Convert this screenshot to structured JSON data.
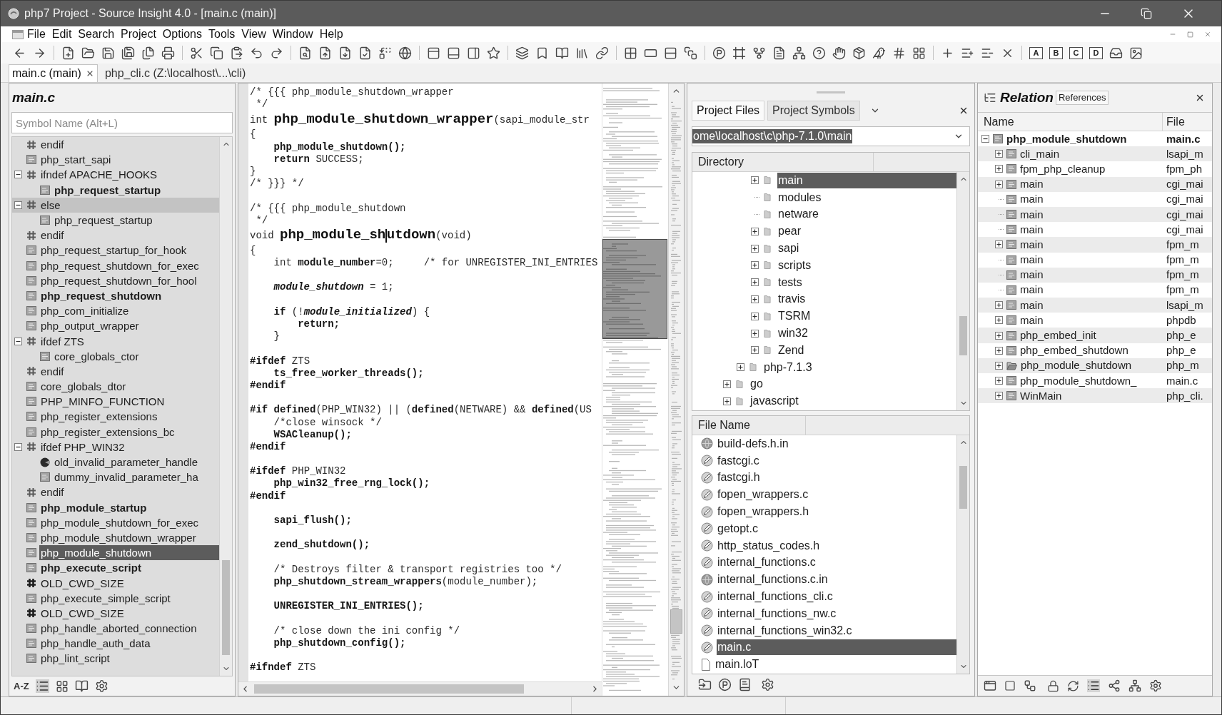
{
  "window": {
    "title": "php7 Project - Source Insight 4.0 - [main.c (main)]"
  },
  "menu_bar": [
    "File",
    "Edit",
    "Search",
    "Project",
    "Options",
    "Tools",
    "View",
    "Window",
    "Help"
  ],
  "toolbar": {
    "bookmark_buttons": [
      "A",
      "B",
      "C",
      "D"
    ]
  },
  "editor_tabs": [
    {
      "label": "main.c (main)",
      "selected": true
    },
    {
      "label": "php_cli.c (Z:\\localhost\\...\\cli)",
      "selected": false
    }
  ],
  "symbol_panel": {
    "title": "main.c",
    "search": {
      "placeholder": "Symbol Name (Alt+L)"
    },
    "sort_button": "A-Z",
    "items": [
      {
        "label": "endif",
        "kind": "directive",
        "bold": false,
        "selected": false,
        "highlighted": false
      },
      {
        "label": "php_start_sapi",
        "kind": "function",
        "bold": false,
        "selected": false,
        "highlighted": false
      },
      {
        "label": "ifndef APACHE_HOOKS",
        "kind": "directive",
        "bold": false,
        "selected": false,
        "highlighted": false,
        "children": [
          {
            "label": "php_request_startup",
            "kind": "function",
            "bold": true,
            "selected": false,
            "highlighted": false
          }
        ]
      },
      {
        "label": "else",
        "kind": "directive",
        "bold": false,
        "selected": false,
        "highlighted": true,
        "children": [
          {
            "label": "php_request_startup",
            "kind": "function",
            "bold": false,
            "selected": false,
            "highlighted": false
          }
        ]
      },
      {
        "label": "endif",
        "kind": "directive",
        "bold": false,
        "selected": false,
        "highlighted": false
      },
      {
        "label": "php_request_startup_for_hook",
        "kind": "function",
        "bold": false,
        "selected": false,
        "highlighted": false
      },
      {
        "label": "php_request_shutdown_for_exec",
        "kind": "function",
        "bold": false,
        "selected": false,
        "highlighted": false
      },
      {
        "label": "php_request_shutdown_for_hool",
        "kind": "function",
        "bold": false,
        "selected": false,
        "highlighted": false
      },
      {
        "label": "php_request_shutdown",
        "kind": "function",
        "bold": true,
        "selected": false,
        "highlighted": false
      },
      {
        "label": "php_com_initialize",
        "kind": "function",
        "bold": false,
        "selected": false,
        "highlighted": false
      },
      {
        "label": "php_output_wrapper",
        "kind": "function",
        "bold": false,
        "selected": false,
        "highlighted": false
      },
      {
        "label": "ifdef ZTS",
        "kind": "directive",
        "bold": false,
        "selected": false,
        "highlighted": false,
        "children": [
          {
            "label": "core_globals_ctor",
            "kind": "function",
            "bold": false,
            "selected": false,
            "highlighted": false
          }
        ]
      },
      {
        "label": "endif",
        "kind": "directive",
        "bold": false,
        "selected": false,
        "highlighted": false
      },
      {
        "label": "core_globals_dtor",
        "kind": "function",
        "bold": false,
        "selected": false,
        "highlighted": false
      },
      {
        "label": "PHP_MINFO_FUNCTION",
        "kind": "function",
        "bold": false,
        "selected": false,
        "highlighted": false
      },
      {
        "label": "php_register_extensions",
        "kind": "function",
        "bold": false,
        "selected": false,
        "highlighted": false
      },
      {
        "label": "php_register_extensions_bc",
        "kind": "function",
        "bold": false,
        "selected": false,
        "highlighted": false
      },
      {
        "label": "ifdef PHP_WIN32",
        "kind": "directive",
        "bold": false,
        "selected": false,
        "highlighted": false,
        "children": [
          {
            "label": "old_invalid_parameter_handle",
            "kind": "variable",
            "bold": false,
            "selected": false,
            "highlighted": false
          },
          {
            "label": "dummy_invalid_parameter_ha",
            "kind": "function",
            "bold": false,
            "selected": false,
            "highlighted": false
          }
        ]
      },
      {
        "label": "endif",
        "kind": "directive",
        "bold": false,
        "selected": false,
        "highlighted": false
      },
      {
        "label": "php_module_startup",
        "kind": "function",
        "bold": true,
        "selected": false,
        "highlighted": false
      },
      {
        "label": "php_module_shutdown_for_exec",
        "kind": "function",
        "bold": false,
        "selected": false,
        "highlighted": false
      },
      {
        "label": "php_module_shutdown_wrapper",
        "kind": "function",
        "bold": false,
        "selected": false,
        "highlighted": false
      },
      {
        "label": "php_module_shutdown",
        "kind": "function",
        "bold": false,
        "selected": true,
        "highlighted": false
      },
      {
        "label": "php_execute_script",
        "kind": "function",
        "bold": true,
        "selected": false,
        "highlighted": false
      },
      {
        "label": "OLD_CWD_SIZE",
        "kind": "macro",
        "bold": false,
        "selected": false,
        "highlighted": false
      },
      {
        "label": "php_execute_simple_script",
        "kind": "function",
        "bold": false,
        "selected": false,
        "highlighted": false
      },
      {
        "label": "OLD_CWD_SIZE",
        "kind": "macro",
        "bold": false,
        "selected": false,
        "highlighted": false
      },
      {
        "label": "php_handle_aborted_connection",
        "kind": "function",
        "bold": false,
        "selected": false,
        "highlighted": false
      },
      {
        "label": "php_handle_auth_data",
        "kind": "function",
        "bold": false,
        "selected": false,
        "highlighted": false
      },
      {
        "label": "php_lint_script",
        "kind": "function",
        "bold": false,
        "selected": false,
        "highlighted": false
      }
    ]
  },
  "editor": {
    "lines": [
      {
        "kind": "text",
        "segments": [
          {
            "kind": "plain",
            "text": "/* {{{ php_module_shutdown_wrapper"
          }
        ]
      },
      {
        "kind": "text",
        "segments": [
          {
            "kind": "plain",
            "text": " */"
          }
        ]
      },
      {
        "kind": "text",
        "segments": [
          {
            "kind": "plain",
            "text": "int "
          },
          {
            "kind": "decl",
            "text": "php_module_shutdown_wrapper"
          },
          {
            "kind": "plain",
            "text": "(sapi_module_str"
          }
        ]
      },
      {
        "kind": "text",
        "segments": [
          {
            "kind": "plain",
            "text": "{"
          }
        ]
      },
      {
        "kind": "text",
        "segments": [
          {
            "kind": "bold",
            "text": "    php_module_shutdown();"
          }
        ]
      },
      {
        "kind": "text",
        "segments": [
          {
            "kind": "bold",
            "text": "    return"
          },
          {
            "kind": "plain",
            "text": " SUCCESS;"
          }
        ]
      },
      {
        "kind": "text",
        "segments": [
          {
            "kind": "plain",
            "text": "}"
          }
        ]
      },
      {
        "kind": "text",
        "segments": [
          {
            "kind": "plain",
            "text": "/* }}} */"
          }
        ]
      },
      {
        "kind": "blank"
      },
      {
        "kind": "text",
        "segments": [
          {
            "kind": "plain",
            "text": "/* {{{ php_module_shutdown"
          }
        ]
      },
      {
        "kind": "text",
        "segments": [
          {
            "kind": "plain",
            "text": " */"
          }
        ]
      },
      {
        "kind": "text",
        "segments": [
          {
            "kind": "plain",
            "text": "void "
          },
          {
            "kind": "decl",
            "text": "php_module_sh"
          },
          {
            "kind": "caret"
          },
          {
            "kind": "decl",
            "text": "utdown"
          },
          {
            "kind": "plain",
            "text": "(void)"
          }
        ]
      },
      {
        "kind": "text",
        "segments": [
          {
            "kind": "plain",
            "text": "{"
          }
        ]
      },
      {
        "kind": "text",
        "segments": [
          {
            "kind": "plain",
            "text": "    int "
          },
          {
            "kind": "bold",
            "text": "module_number"
          },
          {
            "kind": "plain",
            "text": "=0;     /* for UNREGISTER_INI_ENTRIES"
          }
        ]
      },
      {
        "kind": "blank"
      },
      {
        "kind": "text",
        "segments": [
          {
            "kind": "emph",
            "text": "    module_shutdown"
          },
          {
            "kind": "plain",
            "text": " = 1;"
          }
        ]
      },
      {
        "kind": "blank"
      },
      {
        "kind": "text",
        "segments": [
          {
            "kind": "bold",
            "text": "    if"
          },
          {
            "kind": "plain",
            "text": " (!"
          },
          {
            "kind": "emph",
            "text": "module_initialized"
          },
          {
            "kind": "plain",
            "text": ") {"
          }
        ]
      },
      {
        "kind": "text",
        "segments": [
          {
            "kind": "bold",
            "text": "        return;"
          }
        ]
      },
      {
        "kind": "text",
        "segments": [
          {
            "kind": "plain",
            "text": "    }"
          }
        ]
      },
      {
        "kind": "blank"
      },
      {
        "kind": "text",
        "segments": [
          {
            "kind": "bold",
            "text": "#ifdef"
          },
          {
            "kind": "plain",
            "text": " ZTS"
          }
        ]
      },
      {
        "kind": "text",
        "segments": [
          {
            "kind": "bold",
            "text": "    ts_free_worker_threads();"
          }
        ]
      },
      {
        "kind": "text",
        "segments": [
          {
            "kind": "bold",
            "text": "#endif"
          }
        ]
      },
      {
        "kind": "blank"
      },
      {
        "kind": "text",
        "segments": [
          {
            "kind": "bold",
            "text": "#if defined"
          },
          {
            "kind": "plain",
            "text": "(PHP_WIN32) || ("
          },
          {
            "kind": "bold",
            "text": "defined"
          },
          {
            "kind": "plain",
            "text": "(NETWARE) && "
          },
          {
            "kind": "bold",
            "text": "defined"
          },
          {
            "kind": "plain",
            "text": "(US"
          }
        ]
      },
      {
        "kind": "text",
        "segments": [
          {
            "kind": "plain",
            "text": "    /*close winsock */"
          }
        ]
      },
      {
        "kind": "text",
        "segments": [
          {
            "kind": "bold",
            "text": "    WSACleanup();"
          }
        ]
      },
      {
        "kind": "text",
        "segments": [
          {
            "kind": "bold",
            "text": "#endif"
          }
        ]
      },
      {
        "kind": "blank"
      },
      {
        "kind": "text",
        "segments": [
          {
            "kind": "bold",
            "text": "#ifdef"
          },
          {
            "kind": "plain",
            "text": " PHP_WIN32"
          }
        ]
      },
      {
        "kind": "text",
        "segments": [
          {
            "kind": "bold",
            "text": "    php_win32_free_rng_lock();"
          }
        ]
      },
      {
        "kind": "text",
        "segments": [
          {
            "kind": "bold",
            "text": "#endif"
          }
        ]
      },
      {
        "kind": "blank"
      },
      {
        "kind": "text",
        "segments": [
          {
            "kind": "bold",
            "text": "    sapi_flush();"
          }
        ]
      },
      {
        "kind": "blank"
      },
      {
        "kind": "text",
        "segments": [
          {
            "kind": "bold",
            "text": "    zend_shutdown();"
          }
        ]
      },
      {
        "kind": "blank"
      },
      {
        "kind": "text",
        "segments": [
          {
            "kind": "plain",
            "text": "    /* Destroys filter & transport registries too */"
          }
        ]
      },
      {
        "kind": "text",
        "segments": [
          {
            "kind": "bold",
            "text": "    php_shutdown_stream_wrappers"
          },
          {
            "kind": "plain",
            "text": "(module_number);"
          }
        ]
      },
      {
        "kind": "blank"
      },
      {
        "kind": "text",
        "segments": [
          {
            "kind": "bold",
            "text": "    UNREGISTER_INI_ENTRIES();"
          }
        ]
      },
      {
        "kind": "blank"
      },
      {
        "kind": "text",
        "segments": [
          {
            "kind": "plain",
            "text": "    /* close down the ini config */"
          }
        ]
      },
      {
        "kind": "text",
        "segments": [
          {
            "kind": "bold",
            "text": "    php_shutdown_config();"
          }
        ]
      },
      {
        "kind": "blank"
      },
      {
        "kind": "text",
        "segments": [
          {
            "kind": "bold",
            "text": "#ifndef"
          },
          {
            "kind": "plain",
            "text": " ZTS"
          }
        ]
      }
    ]
  },
  "project_panel": {
    "tabs": [
      {
        "label": "Project Files",
        "selected": true
      },
      {
        "label": "Project Symbols",
        "selected": false
      }
    ],
    "path_field": {
      "value": "ome\\localhost\\c\\php-7.1.0\\main",
      "value_selected": true
    },
    "directory": {
      "heading": "Directory",
      "items": [
        {
          "children": [
            {
              "children": [
                {
                  "label": "main",
                  "expandable": true,
                  "selected": true
                },
                {
                  "label": "modules",
                  "expandable": false,
                  "selected": false
                },
                {
                  "label": "netware",
                  "expandable": false,
                  "selected": false
                },
                {
                  "label": "pear",
                  "expandable": true,
                  "selected": false
                },
                {
                  "label": "sapi",
                  "expandable": true,
                  "selected": false
                },
                {
                  "label": "scripts",
                  "expandable": true,
                  "selected": false
                },
                {
                  "label": "tests",
                  "expandable": true,
                  "selected": false
                },
                {
                  "label": "travis",
                  "expandable": true,
                  "selected": false
                },
                {
                  "label": "TSRM",
                  "expandable": true,
                  "selected": false
                },
                {
                  "label": "win32",
                  "expandable": true,
                  "selected": false
                },
                {
                  "label": "Zend",
                  "expandable": true,
                  "selected": false
                }
              ]
            },
            {
              "label": "php-7.1.3",
              "expandable": true,
              "selected": false
            }
          ]
        },
        {
          "label": "go",
          "expandable": true,
          "selected": false
        },
        {
          "label": "javascript",
          "expandable": true,
          "selected": false
        }
      ]
    },
    "files": {
      "heading": "File Name",
      "items": [
        {
          "label": "build-defs.h.in",
          "kind": "template",
          "selected": false
        },
        {
          "label": "fastcgi.c",
          "kind": "source",
          "selected": false
        },
        {
          "label": "fastcgi.h",
          "kind": "source",
          "selected": false
        },
        {
          "label": "fopen_wrappers.c",
          "kind": "source",
          "selected": false
        },
        {
          "label": "fopen_wrappers.h",
          "kind": "source",
          "selected": false
        },
        {
          "label": "getopt.c",
          "kind": "source",
          "selected": false
        },
        {
          "label": "http_status_codes.h",
          "kind": "source",
          "selected": false
        },
        {
          "label": "internal_functions.c",
          "kind": "source",
          "selected": false
        },
        {
          "label": "internal_functions.c.in",
          "kind": "template",
          "selected": false
        },
        {
          "label": "internal_functions_cli.c",
          "kind": "source",
          "selected": false
        },
        {
          "label": "internal_functions_nw.c",
          "kind": "source",
          "selected": false
        },
        {
          "label": "internal_functions_win32.c",
          "kind": "source",
          "selected": false
        },
        {
          "label": "main.c",
          "kind": "source",
          "selected": true
        },
        {
          "label": "main.loT",
          "kind": "plain",
          "selected": false
        }
      ]
    }
  },
  "relation_panel": {
    "title": "Relation",
    "view_button": "References",
    "columns": [
      "Name",
      "File"
    ],
    "items": [
      {
        "label": "php_module_shutdown",
        "file": "main.c",
        "kind": "function",
        "children": [
          {
            "label": "cli_main",
            "file": "lsapi_m",
            "kind": "function",
            "expandable": true
          },
          {
            "label": "fpm_php_cleanup",
            "file": "fpm_ph",
            "kind": "function",
            "expandable": true
          },
          {
            "label": "main",
            "file": "cgi_mai",
            "kind": "function",
            "expandable": true
          },
          {
            "label": "main",
            "file": "cgi_mai",
            "kind": "function",
            "expandable": false
          },
          {
            "label": "main",
            "file": "cgi_mai",
            "kind": "function",
            "expandable": false
          },
          {
            "label": "main",
            "file": "cgi_mai",
            "kind": "function",
            "expandable": false
          },
          {
            "label": "main",
            "file": "fpm_m",
            "kind": "function",
            "expandable": true
          },
          {
            "label": "main",
            "file": "fpm_m",
            "kind": "function",
            "expandable": false
          },
          {
            "label": "main",
            "file": "fpm_m",
            "kind": "function",
            "expandable": false
          },
          {
            "label": "main",
            "file": "fpm_m",
            "kind": "function",
            "expandable": false
          },
          {
            "label": "main",
            "file": "lsapi_m",
            "kind": "function",
            "expandable": true
          },
          {
            "label": "main",
            "file": "phpdb",
            "kind": "function",
            "expandable": true
          },
          {
            "label": "php_embed_init",
            "file": "php_e",
            "kind": "function",
            "expandable": true
          },
          {
            "label": "php_embed_shutdown",
            "file": "php_e",
            "kind": "function",
            "expandable": true
          },
          {
            "label": "php_module_shutdown",
            "file": "php_m",
            "kind": "prototype",
            "expandable": true
          },
          {
            "label": "php_module_shutdown_",
            "file": "main.c",
            "kind": "function",
            "expandable": true
          },
          {
            "label": "WinMain",
            "file": "php_cli.",
            "kind": "function",
            "expandable": true
          }
        ]
      }
    ]
  }
}
